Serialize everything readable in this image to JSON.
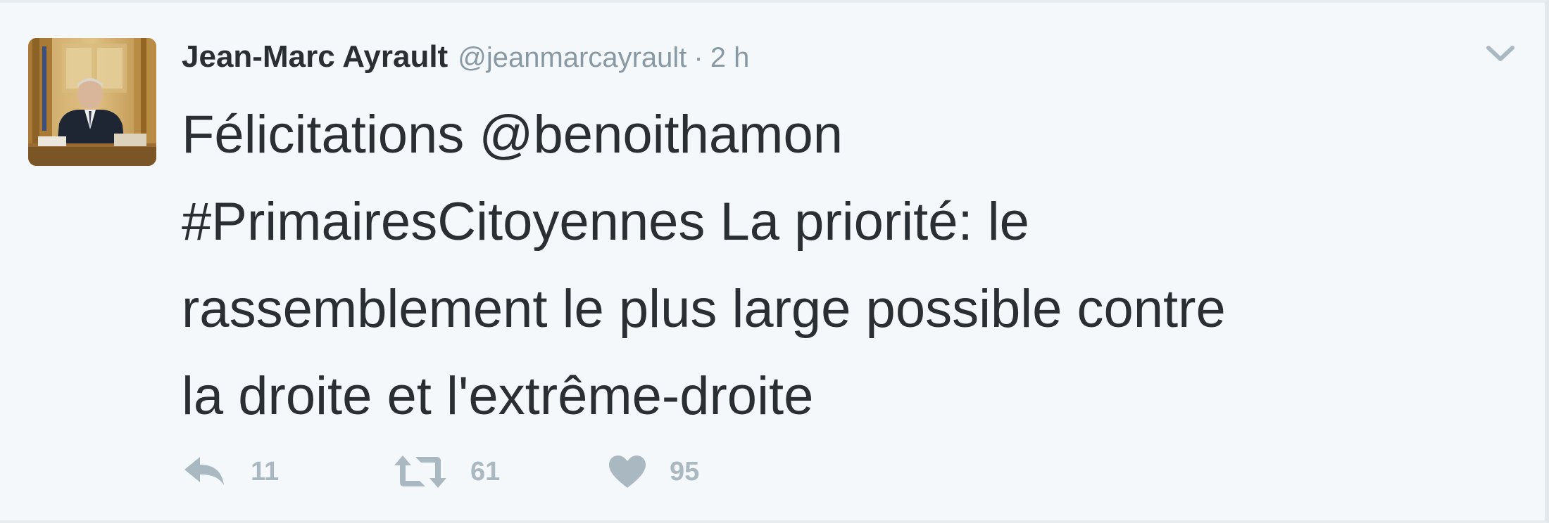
{
  "tweet": {
    "author_name": "Jean-Marc Ayrault",
    "handle": "@jeanmarcayrault",
    "separator": "·",
    "time": "2 h",
    "text_lines": [
      "Félicitations @benoithamon",
      "#PrimairesCitoyennes La priorité: le",
      "rassemblement le plus large possible contre",
      "la droite et l'extrême-droite"
    ],
    "actions": {
      "replies": "11",
      "retweets": "61",
      "likes": "95"
    }
  },
  "icons": {
    "reply": "reply-icon",
    "retweet": "retweet-icon",
    "like": "heart-icon",
    "menu": "chevron-down-icon"
  },
  "colors": {
    "background": "#f5f8fa",
    "text": "#292f33",
    "muted": "#8899a6",
    "icon": "#aab8c2"
  }
}
